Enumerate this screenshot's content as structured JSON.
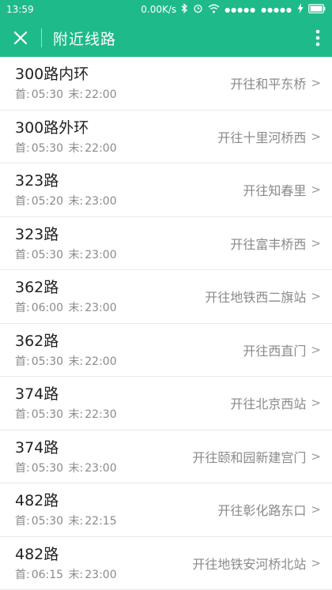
{
  "status_bar": {
    "time": "13:59",
    "net_speed": "0.00K/s",
    "signal_dots": "●●●●●",
    "signal_dots2": "●●●●●"
  },
  "app_bar": {
    "title": "附近线路",
    "colors": {
      "primary": "#1fba8a"
    }
  },
  "routes": [
    {
      "name": "300路内环",
      "first_label": "首:",
      "first": "05:30",
      "last_label": "末:",
      "last": "22:00",
      "dest": "开往和平东桥"
    },
    {
      "name": "300路外环",
      "first_label": "首:",
      "first": "05:30",
      "last_label": "末:",
      "last": "22:00",
      "dest": "开往十里河桥西"
    },
    {
      "name": "323路",
      "first_label": "首:",
      "first": "05:20",
      "last_label": "末:",
      "last": "23:00",
      "dest": "开往知春里"
    },
    {
      "name": "323路",
      "first_label": "首:",
      "first": "05:30",
      "last_label": "末:",
      "last": "23:00",
      "dest": "开往富丰桥西"
    },
    {
      "name": "362路",
      "first_label": "首:",
      "first": "06:00",
      "last_label": "末:",
      "last": "23:00",
      "dest": "开往地铁西二旗站"
    },
    {
      "name": "362路",
      "first_label": "首:",
      "first": "05:30",
      "last_label": "末:",
      "last": "22:00",
      "dest": "开往西直门"
    },
    {
      "name": "374路",
      "first_label": "首:",
      "first": "05:30",
      "last_label": "末:",
      "last": "22:30",
      "dest": "开往北京西站"
    },
    {
      "name": "374路",
      "first_label": "首:",
      "first": "05:30",
      "last_label": "末:",
      "last": "23:00",
      "dest": "开往颐和园新建宫门"
    },
    {
      "name": "482路",
      "first_label": "首:",
      "first": "05:30",
      "last_label": "末:",
      "last": "22:15",
      "dest": "开往彰化路东口"
    },
    {
      "name": "482路",
      "first_label": "首:",
      "first": "06:15",
      "last_label": "末:",
      "last": "23:00",
      "dest": "开往地铁安河桥北站"
    }
  ]
}
